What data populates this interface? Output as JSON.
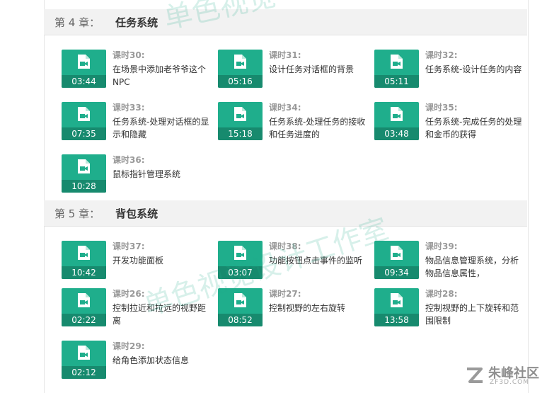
{
  "chapters": [
    {
      "num": "第 4 章：",
      "title": "任务系统"
    },
    {
      "num": "第 5 章：",
      "title": "背包系统"
    }
  ],
  "lessons": [
    {
      "num": "课时30:",
      "title": "在场景中添加老爷爷这个NPC",
      "duration": "03:44"
    },
    {
      "num": "课时31:",
      "title": "设计任务对话框的背景",
      "duration": "05:16"
    },
    {
      "num": "课时32:",
      "title": "任务系统-设计任务的内容",
      "duration": "05:11"
    },
    {
      "num": "课时33:",
      "title": "任务系统-处理对话框的显示和隐藏",
      "duration": "07:35"
    },
    {
      "num": "课时34:",
      "title": "任务系统-处理任务的接收和任务进度的",
      "duration": "15:18"
    },
    {
      "num": "课时35:",
      "title": "任务系统-完成任务的处理和金币的获得",
      "duration": "03:48"
    },
    {
      "num": "课时36:",
      "title": "鼠标指针管理系统",
      "duration": "10:28"
    },
    {
      "num": "课时37:",
      "title": "开发功能面板",
      "duration": "10:42"
    },
    {
      "num": "课时38:",
      "title": "功能按钮点击事件的监听",
      "duration": "03:07"
    },
    {
      "num": "课时39:",
      "title": "物品信息管理系统，分析物品信息属性，",
      "duration": "09:34"
    },
    {
      "num": "课时26:",
      "title": "控制拉近和拉远的视野距离",
      "duration": "02:22"
    },
    {
      "num": "课时27:",
      "title": "控制视野的左右旋转",
      "duration": "08:52"
    },
    {
      "num": "课时28:",
      "title": "控制视野的上下旋转和范围限制",
      "duration": "13:58"
    },
    {
      "num": "课时29:",
      "title": "给角色添加状态信息",
      "duration": "02:12"
    }
  ],
  "watermark": {
    "top": "单色视觉",
    "middle": "单色视觉设计工作室"
  },
  "brand": {
    "name": "朱峰社区",
    "domain": "ZF3D.COM"
  },
  "colors": {
    "accent": "#1fae8c",
    "accent_dark": "#178a6e"
  }
}
